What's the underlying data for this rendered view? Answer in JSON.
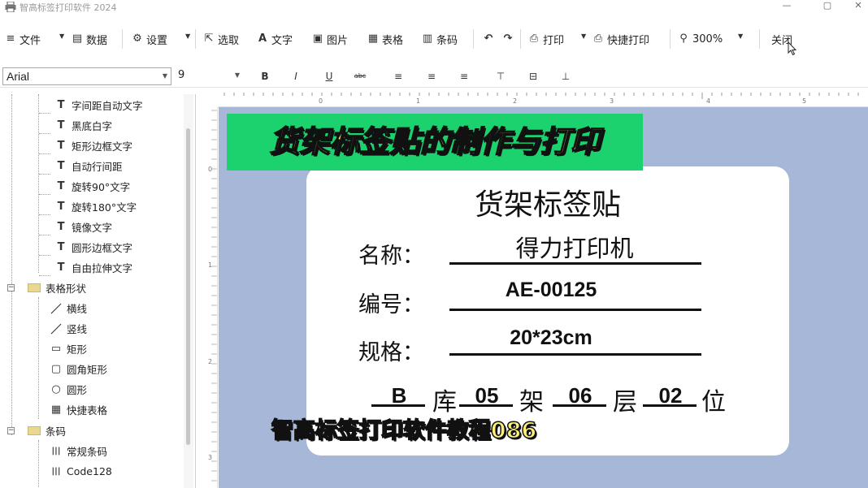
{
  "window": {
    "title": "智高标签打印软件 2024",
    "minimize": "—",
    "maximize": "▢",
    "close": "✕"
  },
  "toolbar": {
    "file": "文件",
    "data": "数据",
    "settings": "设置",
    "select": "选取",
    "text": "文字",
    "picture": "图片",
    "table": "表格",
    "barcode": "条码",
    "print": "打印",
    "quick_print": "快捷打印",
    "zoom": "300%",
    "close": "关闭",
    "icons": {
      "file": "≡",
      "data": "▤",
      "settings": "⚙",
      "select": "⇱",
      "text": "A",
      "picture": "▣",
      "table": "▦",
      "barcode": "▥",
      "undo": "↶",
      "redo": "↷",
      "print": "⎙",
      "quick_print": "⎙",
      "zoom": "⚲"
    }
  },
  "format_bar": {
    "font": "Arial",
    "size": "9",
    "bold": "B",
    "italic": "I",
    "underline": "U",
    "strike": "abc",
    "align_left": "≡",
    "align_center": "≡",
    "align_right": "≡",
    "valign_top": "⊤",
    "valign_middle": "⊟",
    "valign_bottom": "⊥"
  },
  "tree": {
    "text_items": [
      {
        "label": "字间距自动文字",
        "icon": "T"
      },
      {
        "label": "黑底白字",
        "icon": "T"
      },
      {
        "label": "矩形边框文字",
        "icon": "T"
      },
      {
        "label": "自动行间距",
        "icon": "T"
      },
      {
        "label": "旋转90°文字",
        "icon": "T"
      },
      {
        "label": "旋转180°文字",
        "icon": "T"
      },
      {
        "label": "镜像文字",
        "icon": "T"
      },
      {
        "label": "圆形边框文字",
        "icon": "T"
      },
      {
        "label": "自由拉伸文字",
        "icon": "T"
      }
    ],
    "shape_group": "表格形状",
    "shape_items": [
      {
        "label": "横线",
        "icon": "／"
      },
      {
        "label": "竖线",
        "icon": "／"
      },
      {
        "label": "矩形",
        "icon": "▭"
      },
      {
        "label": "圆角矩形",
        "icon": "▢"
      },
      {
        "label": "圆形",
        "icon": "○"
      },
      {
        "label": "快捷表格",
        "icon": "▦"
      }
    ],
    "barcode_group": "条码",
    "barcode_items": [
      {
        "label": "常规条码",
        "icon": "|||"
      },
      {
        "label": "Code128",
        "icon": "|||"
      }
    ],
    "expander_symbol": "−"
  },
  "rulers": {
    "h_ticks": [
      "0",
      "1",
      "2",
      "3",
      "4",
      "5"
    ],
    "v_ticks": [
      "0",
      "1",
      "2",
      "3"
    ]
  },
  "label": {
    "title": "货架标签贴",
    "name_label": "名称：",
    "name_value": "得力打印机",
    "code_label": "编号：",
    "code_value": "AE-00125",
    "spec_label": "规格：",
    "spec_value": "20*23cm",
    "location": {
      "warehouse": "B",
      "warehouse_unit": "库",
      "shelf": "05",
      "shelf_unit": "架",
      "layer": "06",
      "layer_unit": "层",
      "position": "02",
      "position_unit": "位"
    }
  },
  "overlay": {
    "banner": "货架标签贴的制作与打印",
    "subtitle": "智高标签打印软件教程086"
  },
  "colors": {
    "canvas_bg": "#a6b7d8",
    "banner_bg": "#1bd26e",
    "overlay_text": "#fff176"
  }
}
